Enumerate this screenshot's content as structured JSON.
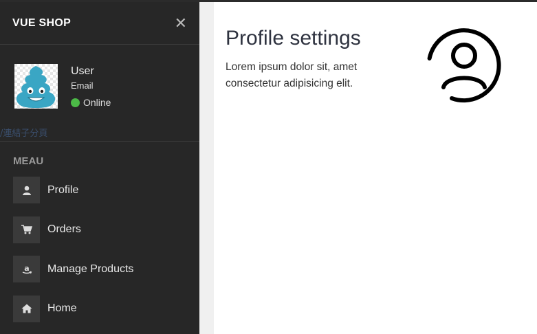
{
  "sidebar": {
    "brand": "VUE SHOP",
    "close_icon": "close-icon",
    "user": {
      "name": "User",
      "email": "Email",
      "status": "Online",
      "status_color": "#4cbb47"
    },
    "broken_link_text": "/連結子分頁",
    "menu_title": "MEAU",
    "items": [
      {
        "label": "Profile",
        "icon": "user-icon"
      },
      {
        "label": "Orders",
        "icon": "cart-icon"
      },
      {
        "label": "Manage Products",
        "icon": "amazon-icon"
      },
      {
        "label": "Home",
        "icon": "home-icon"
      }
    ]
  },
  "main": {
    "title": "Profile settings",
    "description": "Lorem ipsum dolor sit, amet consectetur adipisicing elit.",
    "illustration": "user-circle-icon"
  },
  "colors": {
    "sidebar_bg": "#272727",
    "icon_box_bg": "#3a3a3a",
    "online_green": "#4cbb47"
  }
}
